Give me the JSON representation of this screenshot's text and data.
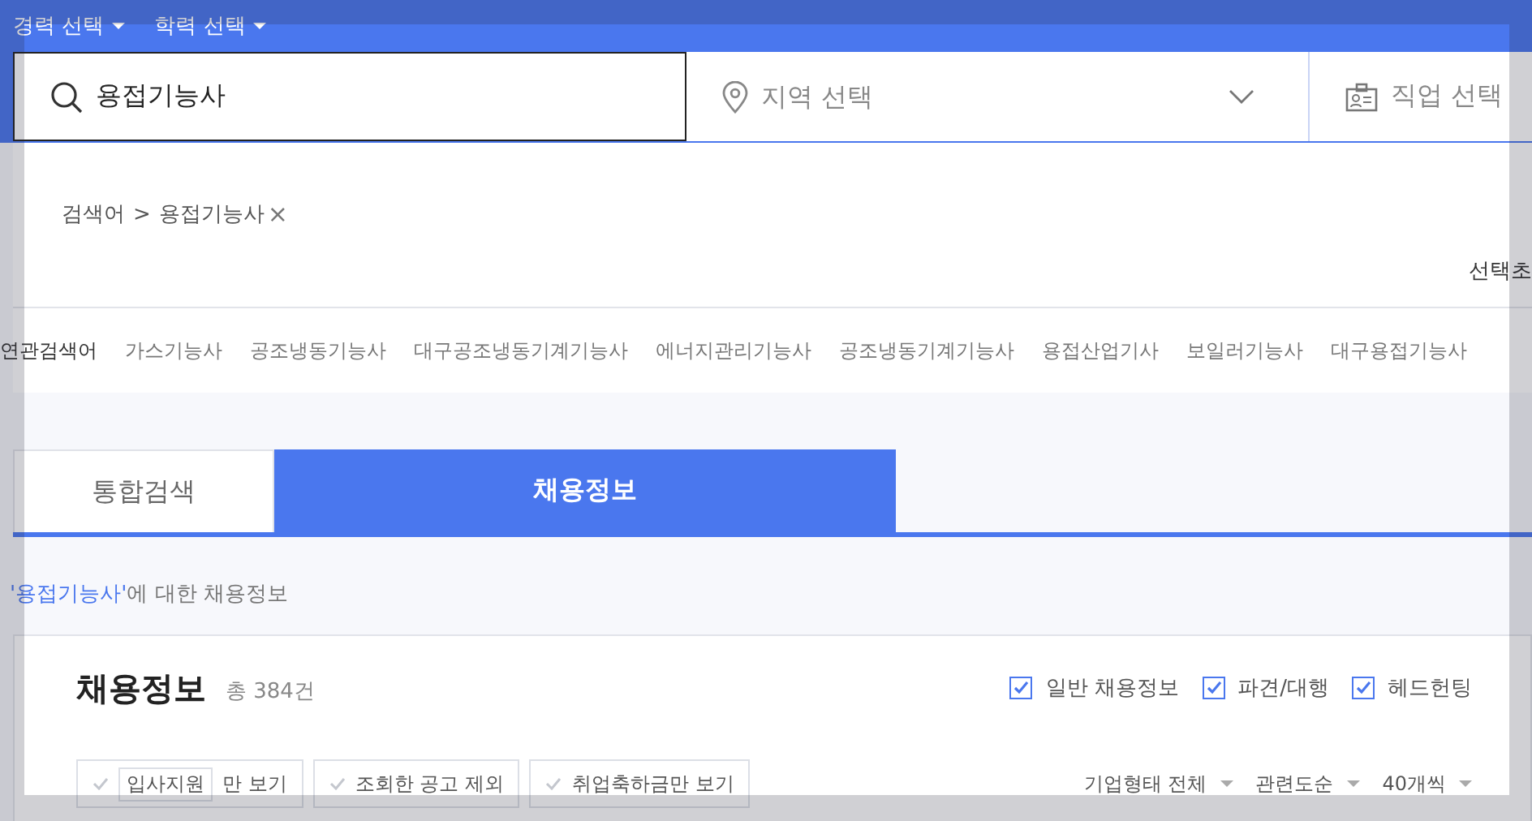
{
  "top_menu": [
    {
      "label": "경력 선택"
    },
    {
      "label": "학력 선택"
    }
  ],
  "search": {
    "value": "용접기능사"
  },
  "region": {
    "placeholder": "지역 선택"
  },
  "job": {
    "label": "직업 선택"
  },
  "breadcrumb": {
    "label": "검색어",
    "separator": ">",
    "term": "용접기능사",
    "remove": "×"
  },
  "reset": {
    "label": "선택초"
  },
  "related": {
    "label": "연관검색어",
    "terms": [
      "가스기능사",
      "공조냉동기능사",
      "대구공조냉동기계기능사",
      "에너지관리기능사",
      "공조냉동기계기능사",
      "용접산업기사",
      "보일러기능사",
      "대구용접기능사"
    ]
  },
  "tabs": [
    {
      "label": "통합검색",
      "selected": false
    },
    {
      "label": "채용정보",
      "selected": true
    }
  ],
  "caption": {
    "keyword": "'용접기능사'",
    "text": "에 대한 채용정보"
  },
  "results": {
    "title": "채용정보",
    "total": "총 384건",
    "types": [
      {
        "label": "일반 채용정보",
        "checked": true
      },
      {
        "label": "파견/대행",
        "checked": true
      },
      {
        "label": "헤드헌팅",
        "checked": true
      }
    ],
    "chips": [
      {
        "tag": "입사지원",
        "label": "만 보기",
        "selected": false
      },
      {
        "label": "조회한 공고 제외",
        "selected": false
      },
      {
        "label": "취업축하금만 보기",
        "selected": false
      }
    ],
    "sorts": [
      {
        "label": "기업형태 전체"
      },
      {
        "label": "관련도순"
      },
      {
        "label": "40개씩"
      }
    ]
  }
}
